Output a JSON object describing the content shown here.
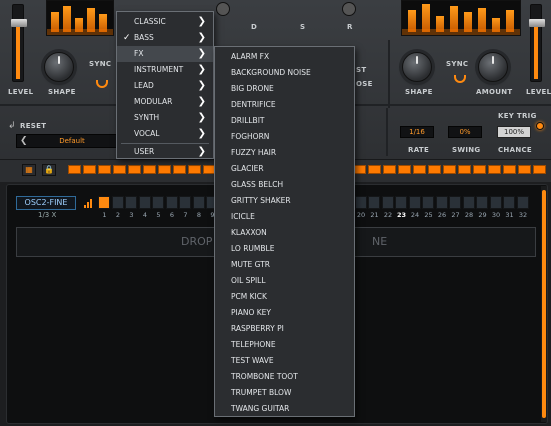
{
  "top": {
    "left_panel": {
      "level_label": "LEVEL",
      "shape_label": "SHAPE",
      "sync_label": "SYNC",
      "knob_labels": [
        "D",
        "S",
        "R"
      ]
    },
    "right_panel": {
      "shape_label": "SHAPE",
      "sync_label": "SYNC",
      "amount_label": "AMOUNT",
      "level_label": "LEVEL",
      "partial_labels": [
        "ST",
        "OSE"
      ]
    },
    "reset_label": "RESET",
    "preset_value": "Default",
    "key_trig_label": "KEY TRIG",
    "rate_value": "1/16",
    "rate_label": "RATE",
    "swing_value": "0%",
    "swing_label": "SWING",
    "chance_value": "100%",
    "chance_label": "CHANCE"
  },
  "sequencer": {
    "param_name": "OSC2-FINE",
    "rate_text": "1/3 X",
    "visible_left_steps": [
      "1",
      "2",
      "3",
      "4",
      "5",
      "6",
      "7",
      "8",
      "9"
    ],
    "visible_right_steps": [
      "20",
      "21",
      "22",
      "23",
      "24",
      "25",
      "26",
      "27",
      "28",
      "29",
      "30",
      "31",
      "32"
    ],
    "active_step": "23",
    "drop_text_left": "DROP",
    "drop_text_right": "NE"
  },
  "menu": {
    "items": [
      {
        "label": "CLASSIC",
        "checked": false,
        "has_submenu": true
      },
      {
        "label": "BASS",
        "checked": true,
        "has_submenu": true
      },
      {
        "label": "FX",
        "checked": false,
        "has_submenu": true,
        "highlighted": true
      },
      {
        "label": "INSTRUMENT",
        "checked": false,
        "has_submenu": true
      },
      {
        "label": "LEAD",
        "checked": false,
        "has_submenu": true
      },
      {
        "label": "MODULAR",
        "checked": false,
        "has_submenu": true
      },
      {
        "label": "SYNTH",
        "checked": false,
        "has_submenu": true
      },
      {
        "label": "VOCAL",
        "checked": false,
        "has_submenu": true
      },
      {
        "label": "USER",
        "checked": false,
        "has_submenu": true
      }
    ],
    "check_glyph": "✓",
    "submenu_glyph": "❯"
  },
  "submenu": {
    "parent": "FX",
    "items": [
      "ALARM FX",
      "BACKGROUND NOISE",
      "BIG DRONE",
      "DENTRIFICE",
      "DRILLBIT",
      "FOGHORN",
      "FUZZY HAIR",
      "GLACIER",
      "GLASS BELCH",
      "GRITTY SHAKER",
      "ICICLE",
      "KLAXXON",
      "LO RUMBLE",
      "MUTE GTR",
      "OIL SPILL",
      "PCM KICK",
      "PIANO KEY",
      "RASPBERRY PI",
      "TELEPHONE",
      "TEST WAVE",
      "TROMBONE TOOT",
      "TRUMPET BLOW",
      "TWANG GUITAR"
    ]
  },
  "colors": {
    "accent": "#ff8a10",
    "menu_bg": "#2b2d30",
    "menu_border": "#6a6f75",
    "panel_bg": "#3b3e42"
  }
}
